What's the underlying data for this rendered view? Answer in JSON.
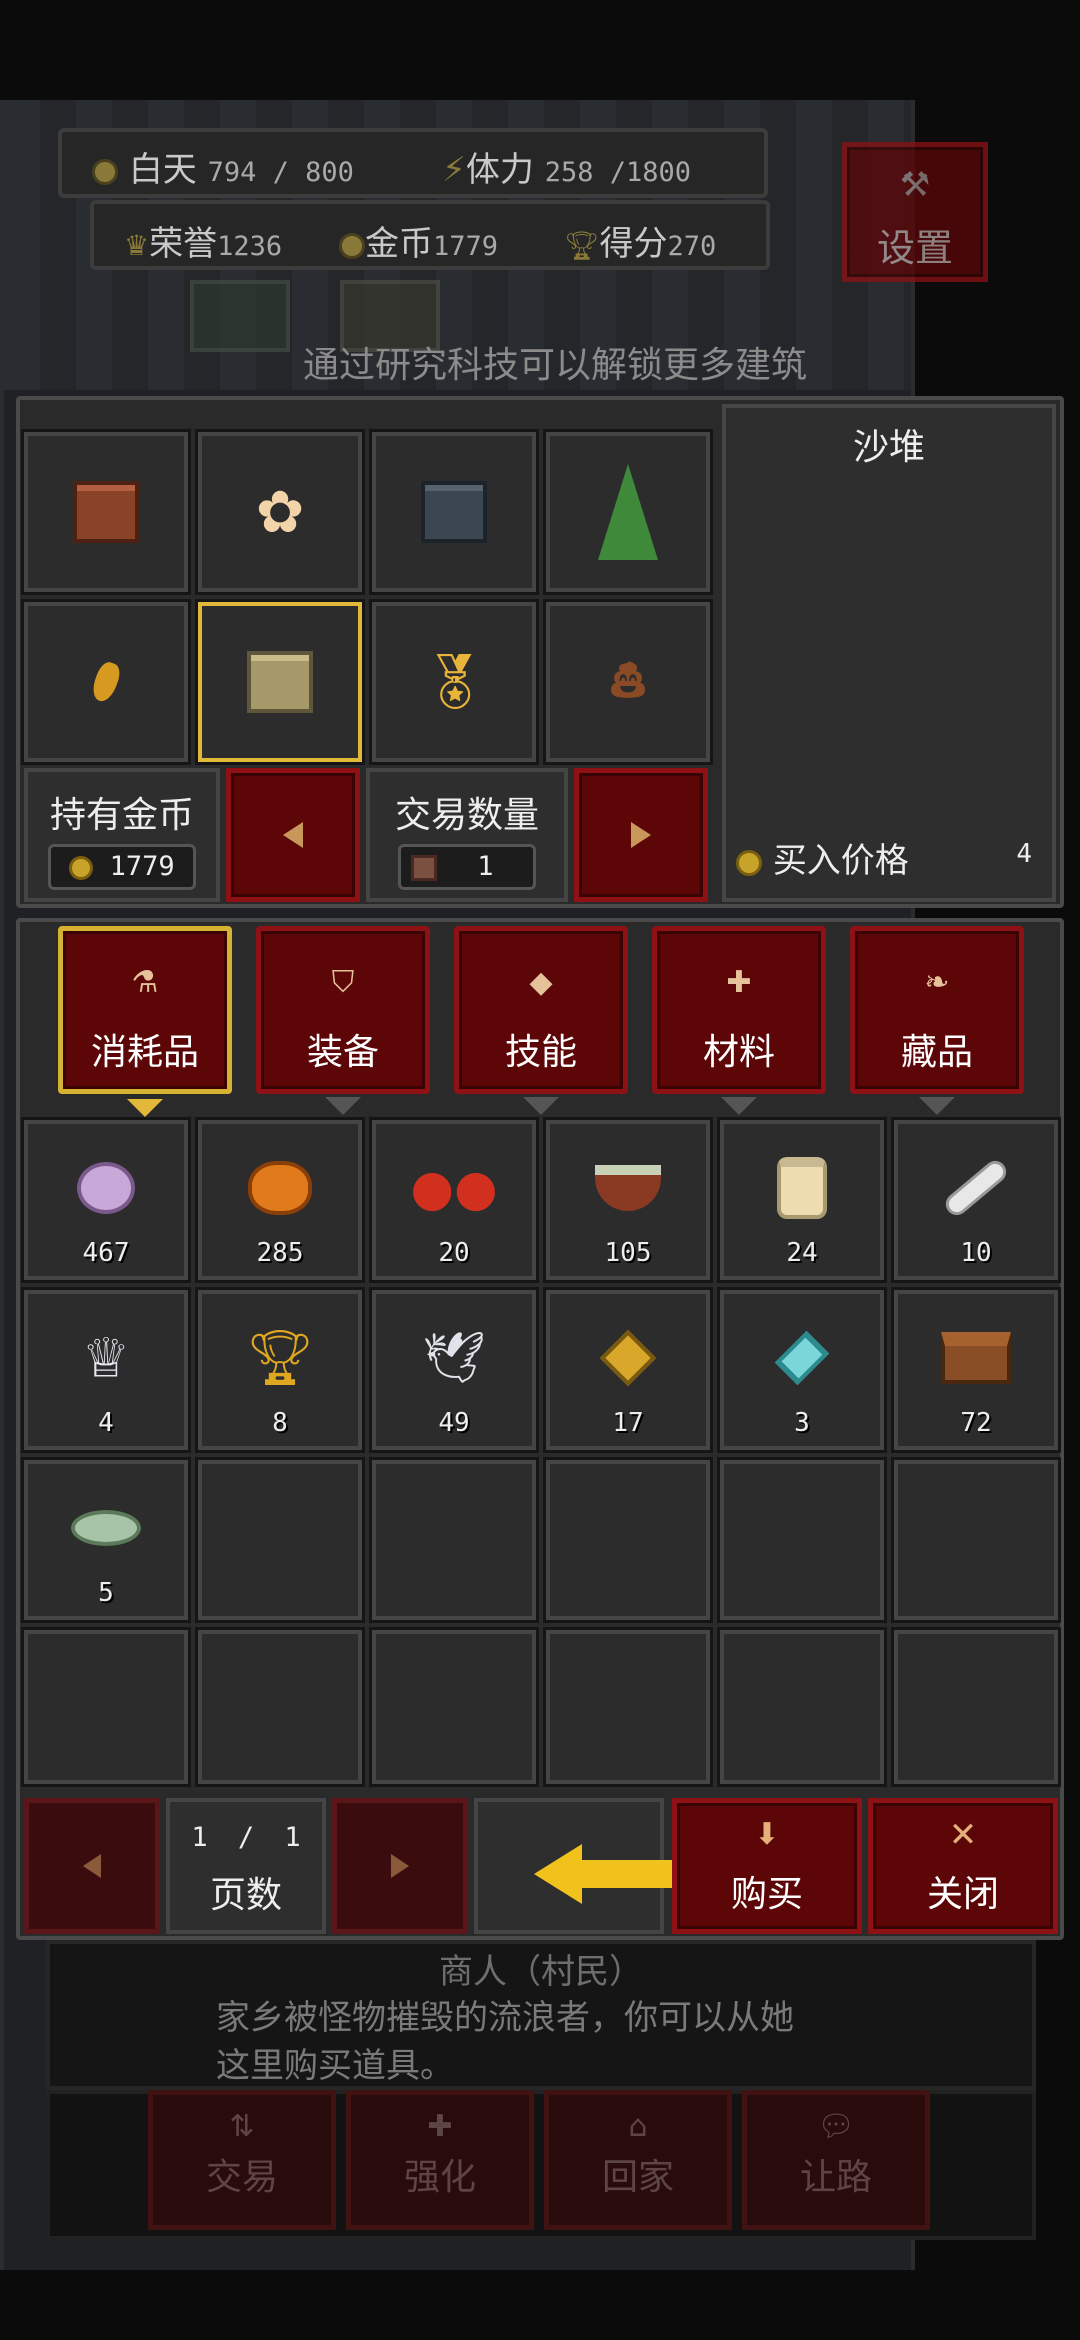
{
  "hud": {
    "day_label": "白天",
    "day_value": "794 / 800",
    "stamina_label": "体力",
    "stamina_value": "258 /1800",
    "honor_label": "荣誉",
    "honor_value": "1236",
    "gold_label": "金币",
    "gold_value": "1779",
    "score_label": "得分",
    "score_value": "270",
    "settings_label": "设置"
  },
  "hint": "通过研究科技可以解锁更多建筑",
  "building": {
    "items": [
      {
        "icon": "brown-block-icon"
      },
      {
        "icon": "flower-icon"
      },
      {
        "icon": "stone-block-icon"
      },
      {
        "icon": "tree-icon"
      },
      {
        "icon": "amber-shard-icon"
      },
      {
        "icon": "sand-block-icon",
        "selected": true
      },
      {
        "icon": "medal-icon"
      },
      {
        "icon": "poop-icon"
      }
    ],
    "selected_name": "沙堆",
    "gold_label": "持有金币",
    "gold_value": "1779",
    "qty_label": "交易数量",
    "qty_value": "1",
    "price_label": "买入价格",
    "price_value": "4"
  },
  "tabs": [
    {
      "label": "消耗品",
      "icon": "flask-icon",
      "active": true
    },
    {
      "label": "装备",
      "icon": "shield-icon"
    },
    {
      "label": "技能",
      "icon": "diamond-icon"
    },
    {
      "label": "材料",
      "icon": "material-icon"
    },
    {
      "label": "藏品",
      "icon": "scroll-icon"
    }
  ],
  "items": [
    {
      "icon": "turnip-icon",
      "count": "467"
    },
    {
      "icon": "pumpkin-icon",
      "count": "285"
    },
    {
      "icon": "berries-icon",
      "count": "20"
    },
    {
      "icon": "soup-bowl-icon",
      "count": "105"
    },
    {
      "icon": "jar-icon",
      "count": "24"
    },
    {
      "icon": "bone-icon",
      "count": "10"
    },
    {
      "icon": "crown-icon",
      "count": "4"
    },
    {
      "icon": "chalice-icon",
      "count": "8"
    },
    {
      "icon": "winged-statue-icon",
      "count": "49"
    },
    {
      "icon": "gold-relic-icon",
      "count": "17"
    },
    {
      "icon": "crystal-icon",
      "count": "3"
    },
    {
      "icon": "chest-icon",
      "count": "72"
    },
    {
      "icon": "fish-icon",
      "count": "5"
    }
  ],
  "pager": {
    "current": "1",
    "sep": "/",
    "total": "1",
    "label": "页数"
  },
  "buy_label": "购买",
  "close_label": "关闭",
  "merchant": {
    "title": "商人（村民）",
    "desc_line1": "家乡被怪物摧毁的流浪者，你可以从她",
    "desc_line2": "这里购买道具。"
  },
  "actions": [
    "交易",
    "强化",
    "回家",
    "让路"
  ],
  "colors": {
    "accent_gold": "#e1b83a",
    "button_red": "#5c0608",
    "arrow_yellow": "#f2c21c"
  }
}
